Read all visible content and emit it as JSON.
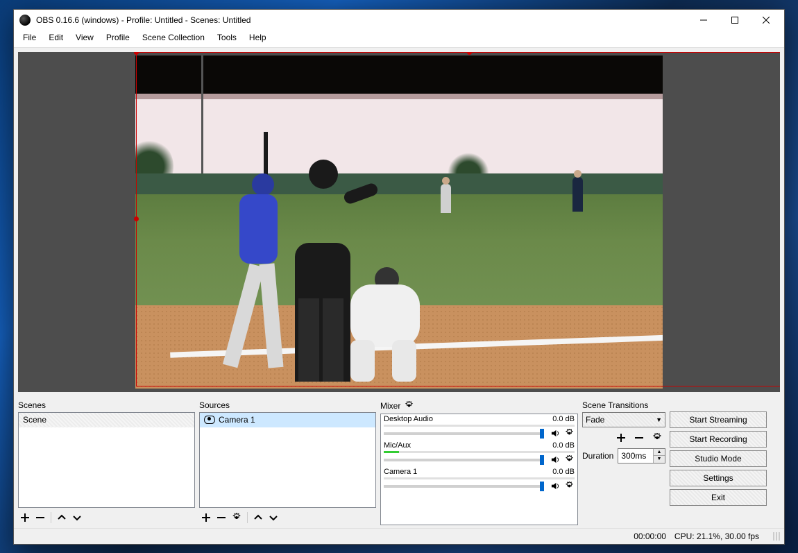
{
  "window": {
    "title": "OBS 0.16.6 (windows) - Profile: Untitled - Scenes: Untitled"
  },
  "menu": {
    "items": [
      "File",
      "Edit",
      "View",
      "Profile",
      "Scene Collection",
      "Tools",
      "Help"
    ]
  },
  "panels": {
    "scenes": {
      "title": "Scenes",
      "items": [
        "Scene"
      ]
    },
    "sources": {
      "title": "Sources",
      "items": [
        {
          "name": "Camera 1",
          "visible": true,
          "selected": true
        }
      ]
    },
    "mixer": {
      "title": "Mixer",
      "channels": [
        {
          "name": "Desktop Audio",
          "level": "0.0 dB"
        },
        {
          "name": "Mic/Aux",
          "level": "0.0 dB"
        },
        {
          "name": "Camera 1",
          "level": "0.0 dB"
        }
      ]
    },
    "transitions": {
      "title": "Scene Transitions",
      "selected": "Fade",
      "duration_label": "Duration",
      "duration_value": "300ms"
    }
  },
  "controls": {
    "buttons": [
      "Start Streaming",
      "Start Recording",
      "Studio Mode",
      "Settings",
      "Exit"
    ]
  },
  "status": {
    "time": "00:00:00",
    "cpu": "CPU: 21.1%, 30.00 fps"
  }
}
